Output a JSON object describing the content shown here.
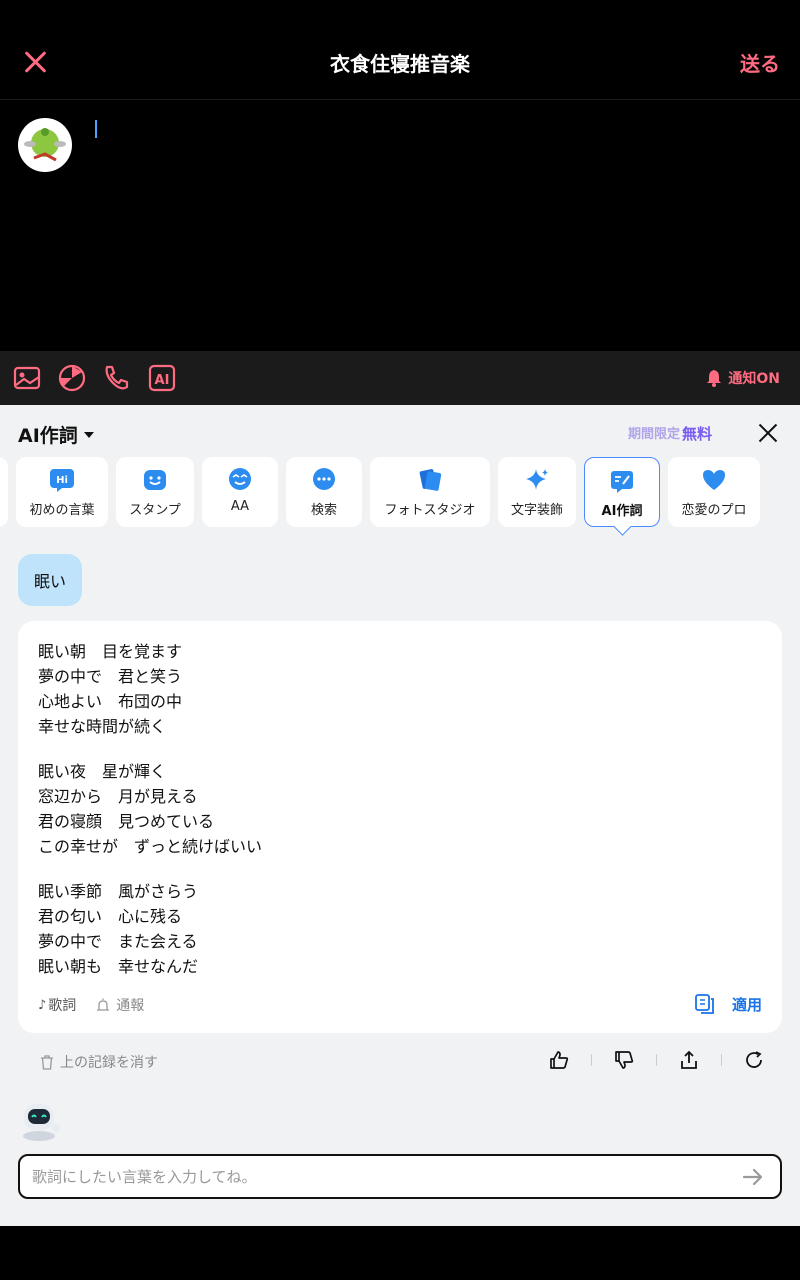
{
  "header": {
    "title": "衣食住寝推音楽",
    "send_label": "送る"
  },
  "toolbar": {
    "notify_label": "通知ON"
  },
  "panel": {
    "title": "AI作詞",
    "promo_period": "期間限定",
    "promo_free": "無料",
    "tools": [
      {
        "label": "初めの言葉",
        "icon": "hi-icon"
      },
      {
        "label": "スタンプ",
        "icon": "sticker-icon"
      },
      {
        "label": "AA",
        "icon": "face-icon"
      },
      {
        "label": "検索",
        "icon": "search-bubble-icon"
      },
      {
        "label": "フォトスタジオ",
        "icon": "photo-studio-icon"
      },
      {
        "label": "文字装飾",
        "icon": "sparkle-icon"
      },
      {
        "label": "AI作詞",
        "icon": "ai-lyrics-icon"
      },
      {
        "label": "恋愛のプロ",
        "icon": "heart-icon"
      }
    ]
  },
  "chat": {
    "user_message": "眠い",
    "lyrics": [
      [
        "眠い朝　目を覚ます",
        "夢の中で　君と笑う",
        "心地よい　布団の中",
        "幸せな時間が続く"
      ],
      [
        "眠い夜　星が輝く",
        "窓辺から　月が見える",
        "君の寝顔　見つめている",
        "この幸せが　ずっと続けばいい"
      ],
      [
        "眠い季節　風がさらう",
        "君の匂い　心に残る",
        "夢の中で　また会える",
        "眠い朝も　幸せなんだ"
      ]
    ],
    "lyrics_label": "歌詞",
    "report_label": "通報",
    "apply_label": "適用",
    "clear_label": "上の記録を消す"
  },
  "input": {
    "placeholder": "歌詞にしたい言葉を入力してね。",
    "value": ""
  },
  "colors": {
    "accent": "#ff6b81",
    "link": "#1a73e8",
    "bubble": "#bfe3fb"
  }
}
